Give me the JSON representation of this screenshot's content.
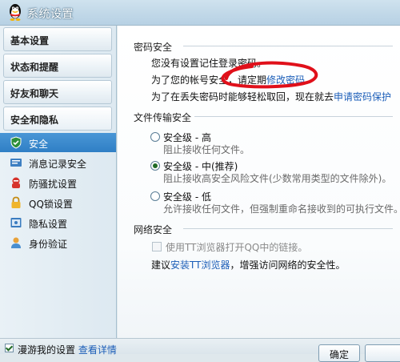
{
  "window": {
    "title": "系统设置"
  },
  "sidebar": {
    "categories": [
      {
        "label": "基本设置"
      },
      {
        "label": "状态和提醒"
      },
      {
        "label": "好友和聊天"
      },
      {
        "label": "安全和隐私"
      }
    ],
    "items": [
      {
        "label": "安全",
        "icon": "shield-icon",
        "selected": true
      },
      {
        "label": "消息记录安全",
        "icon": "message-record-icon"
      },
      {
        "label": "防骚扰设置",
        "icon": "anti-harassment-icon"
      },
      {
        "label": "QQ锁设置",
        "icon": "lock-icon"
      },
      {
        "label": "隐私设置",
        "icon": "privacy-icon"
      },
      {
        "label": "身份验证",
        "icon": "user-verify-icon"
      }
    ]
  },
  "main": {
    "password": {
      "title": "密码安全",
      "line1": "您没有设置记住登录密码。",
      "line2_prefix": "为了您的帐号安全，请定期",
      "line2_link": "修改密码",
      "line2_suffix": "。",
      "line3_prefix": "为了在丢失密码时能够轻松取回，现在就去",
      "line3_link": "申请密码保护"
    },
    "transfer": {
      "title": "文件传输安全",
      "options": [
        {
          "title": "安全级 - 高",
          "desc": "阻止接收任何文件。",
          "checked": false
        },
        {
          "title": "安全级 - 中(推荐)",
          "desc": "阻止接收高安全风险文件(少数常用类型的文件除外)。",
          "checked": true
        },
        {
          "title": "安全级 - 低",
          "desc": "允许接收任何文件，但强制重命名接收到的可执行文件。",
          "checked": false
        }
      ]
    },
    "network": {
      "title": "网络安全",
      "checkbox_label": "使用TT浏览器打开QQ中的链接。",
      "suggest_prefix": "建议",
      "suggest_link": "安装TT浏览器",
      "suggest_suffix": "，增强访问网络的安全性。"
    }
  },
  "bottom": {
    "checkbox_text": "漫游我的设置",
    "link_text": "查看详情",
    "ok_button": "确定"
  },
  "colors": {
    "annotation": "#e0101a",
    "link": "#1c5eb8",
    "selected_item": "#2f7fc5"
  }
}
